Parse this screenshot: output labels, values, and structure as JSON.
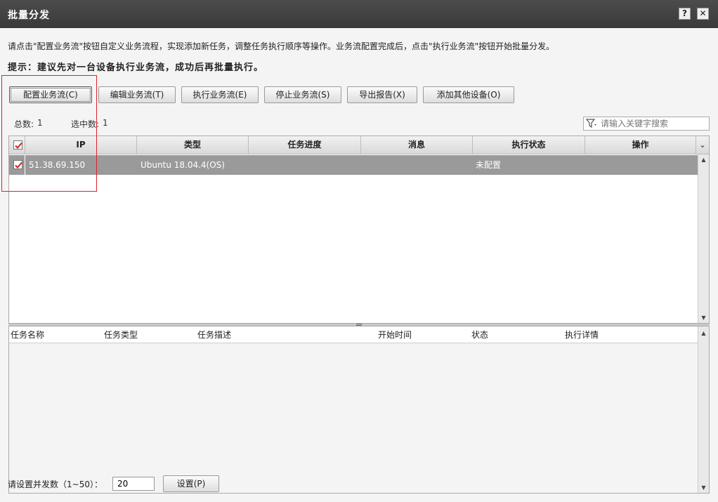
{
  "window": {
    "title": "批量分发",
    "help_label": "?",
    "close_label": "✕"
  },
  "instructions": "请点击\"配置业务流\"按钮自定义业务流程，实现添加新任务，调整任务执行顺序等操作。业务流配置完成后，点击\"执行业务流\"按钮开始批量分发。",
  "tip": "提示：建议先对一台设备执行业务流，成功后再批量执行。",
  "toolbar": {
    "configure": "配置业务流(C)",
    "edit": "编辑业务流(T)",
    "execute": "执行业务流(E)",
    "stop": "停止业务流(S)",
    "export": "导出报告(X)",
    "add_device": "添加其他设备(O)"
  },
  "summary": {
    "total_label": "总数:",
    "total_value": "1",
    "selected_label": "选中数:",
    "selected_value": "1"
  },
  "search": {
    "placeholder": "请输入关键字搜索"
  },
  "device_table": {
    "headers": [
      "IP",
      "类型",
      "任务进度",
      "消息",
      "执行状态",
      "操作"
    ],
    "rows": [
      {
        "checked": true,
        "ip": "51.38.69.150",
        "type": "Ubuntu 18.04.4(OS)",
        "progress": "",
        "message": "",
        "status": "未配置",
        "action": ""
      }
    ]
  },
  "task_table": {
    "headers": [
      "任务名称",
      "任务类型",
      "任务描述",
      "开始时间",
      "状态",
      "执行详情"
    ]
  },
  "concurrency": {
    "label": "请设置并发数（1~50）：",
    "value": "20",
    "set_button": "设置(P)"
  },
  "colors": {
    "titlebar": "#3f3f3f",
    "selected_row": "#9a9a9a",
    "highlight_box": "#e0202a",
    "check_mark": "#cc2222"
  }
}
